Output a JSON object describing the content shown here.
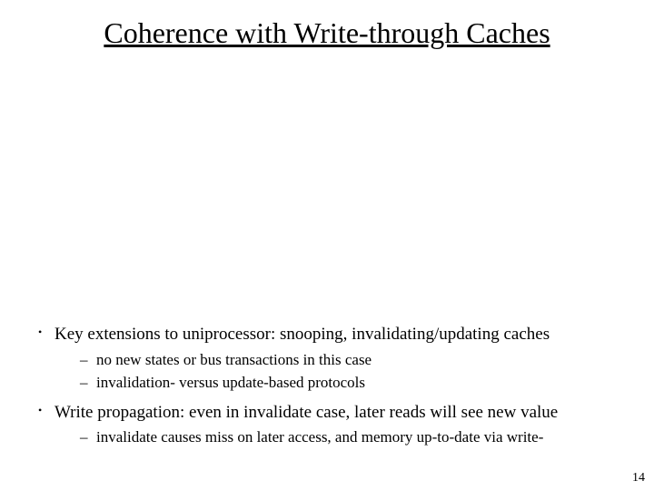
{
  "title": "Coherence with Write-through Caches",
  "bullets": [
    {
      "text": "Key extensions to uniprocessor: snooping, invalidating/updating caches",
      "sub": [
        "no new states or bus transactions in this case",
        "invalidation- versus update-based protocols"
      ]
    },
    {
      "text": "Write propagation: even in invalidate case, later reads will see new value",
      "sub": [
        "invalidate causes miss on later access, and memory up-to-date via write-"
      ]
    }
  ],
  "page_number": "14"
}
